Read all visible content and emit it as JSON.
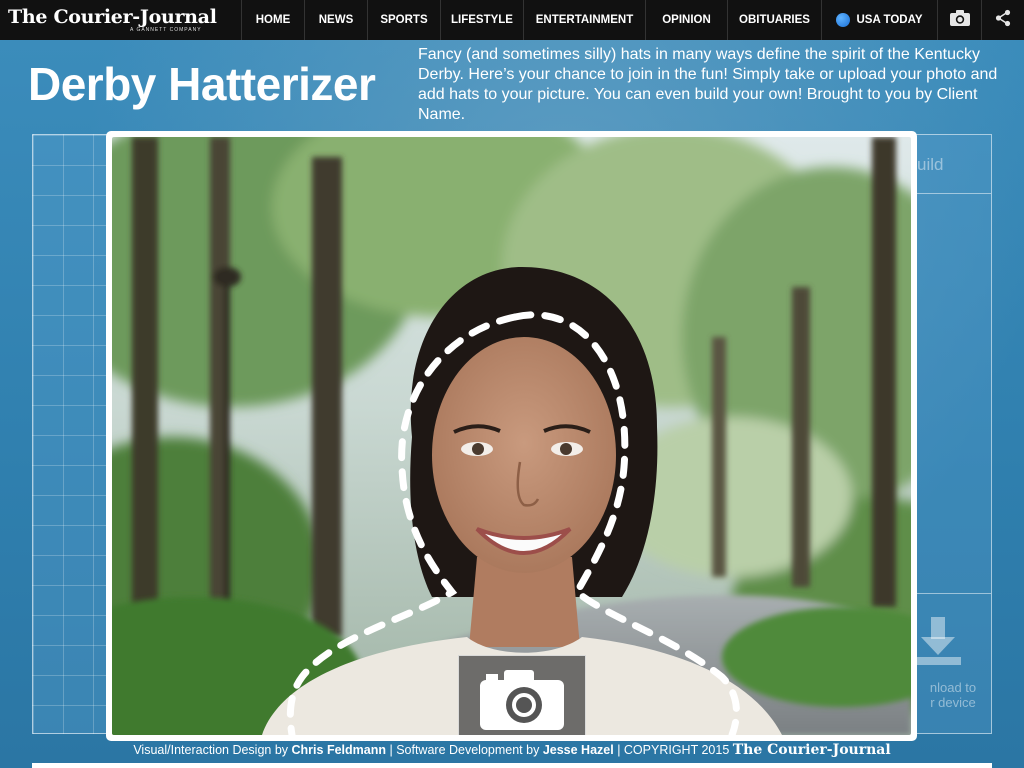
{
  "header": {
    "logo": "The Courier-Journal",
    "logo_sub": "A GANNETT COMPANY"
  },
  "nav": {
    "items": [
      {
        "label": "HOME"
      },
      {
        "label": "NEWS"
      },
      {
        "label": "SPORTS"
      },
      {
        "label": "LIFESTYLE"
      },
      {
        "label": "ENTERTAINMENT"
      },
      {
        "label": "OPINION"
      },
      {
        "label": "OBITUARIES"
      }
    ],
    "usa_today": "USA TODAY",
    "icons": [
      "camera-icon",
      "share-icon"
    ]
  },
  "page": {
    "title": "Derby Hatterizer",
    "description": "Fancy (and sometimes silly) hats in many ways define the spirit of the Kentucky Derby. Here’s your chance to join in the fun! Simply take or upload your photo and add hats to your picture. You can even build your own! Brought to you by Client Name."
  },
  "side": {
    "build_label": "uild",
    "download_line1": "nload to",
    "download_line2": "r device"
  },
  "footer": {
    "design_prefix": "Visual/Interaction Design by",
    "designer": "Chris Feldmann",
    "dev_prefix": "| Software Development by",
    "developer": "Jesse Hazel",
    "copyright": "| COPYRIGHT 2015",
    "brand": "The Courier-Journal"
  },
  "colors": {
    "background": "#2f7fae",
    "topbar": "#111111",
    "frame": "#ffffff"
  }
}
